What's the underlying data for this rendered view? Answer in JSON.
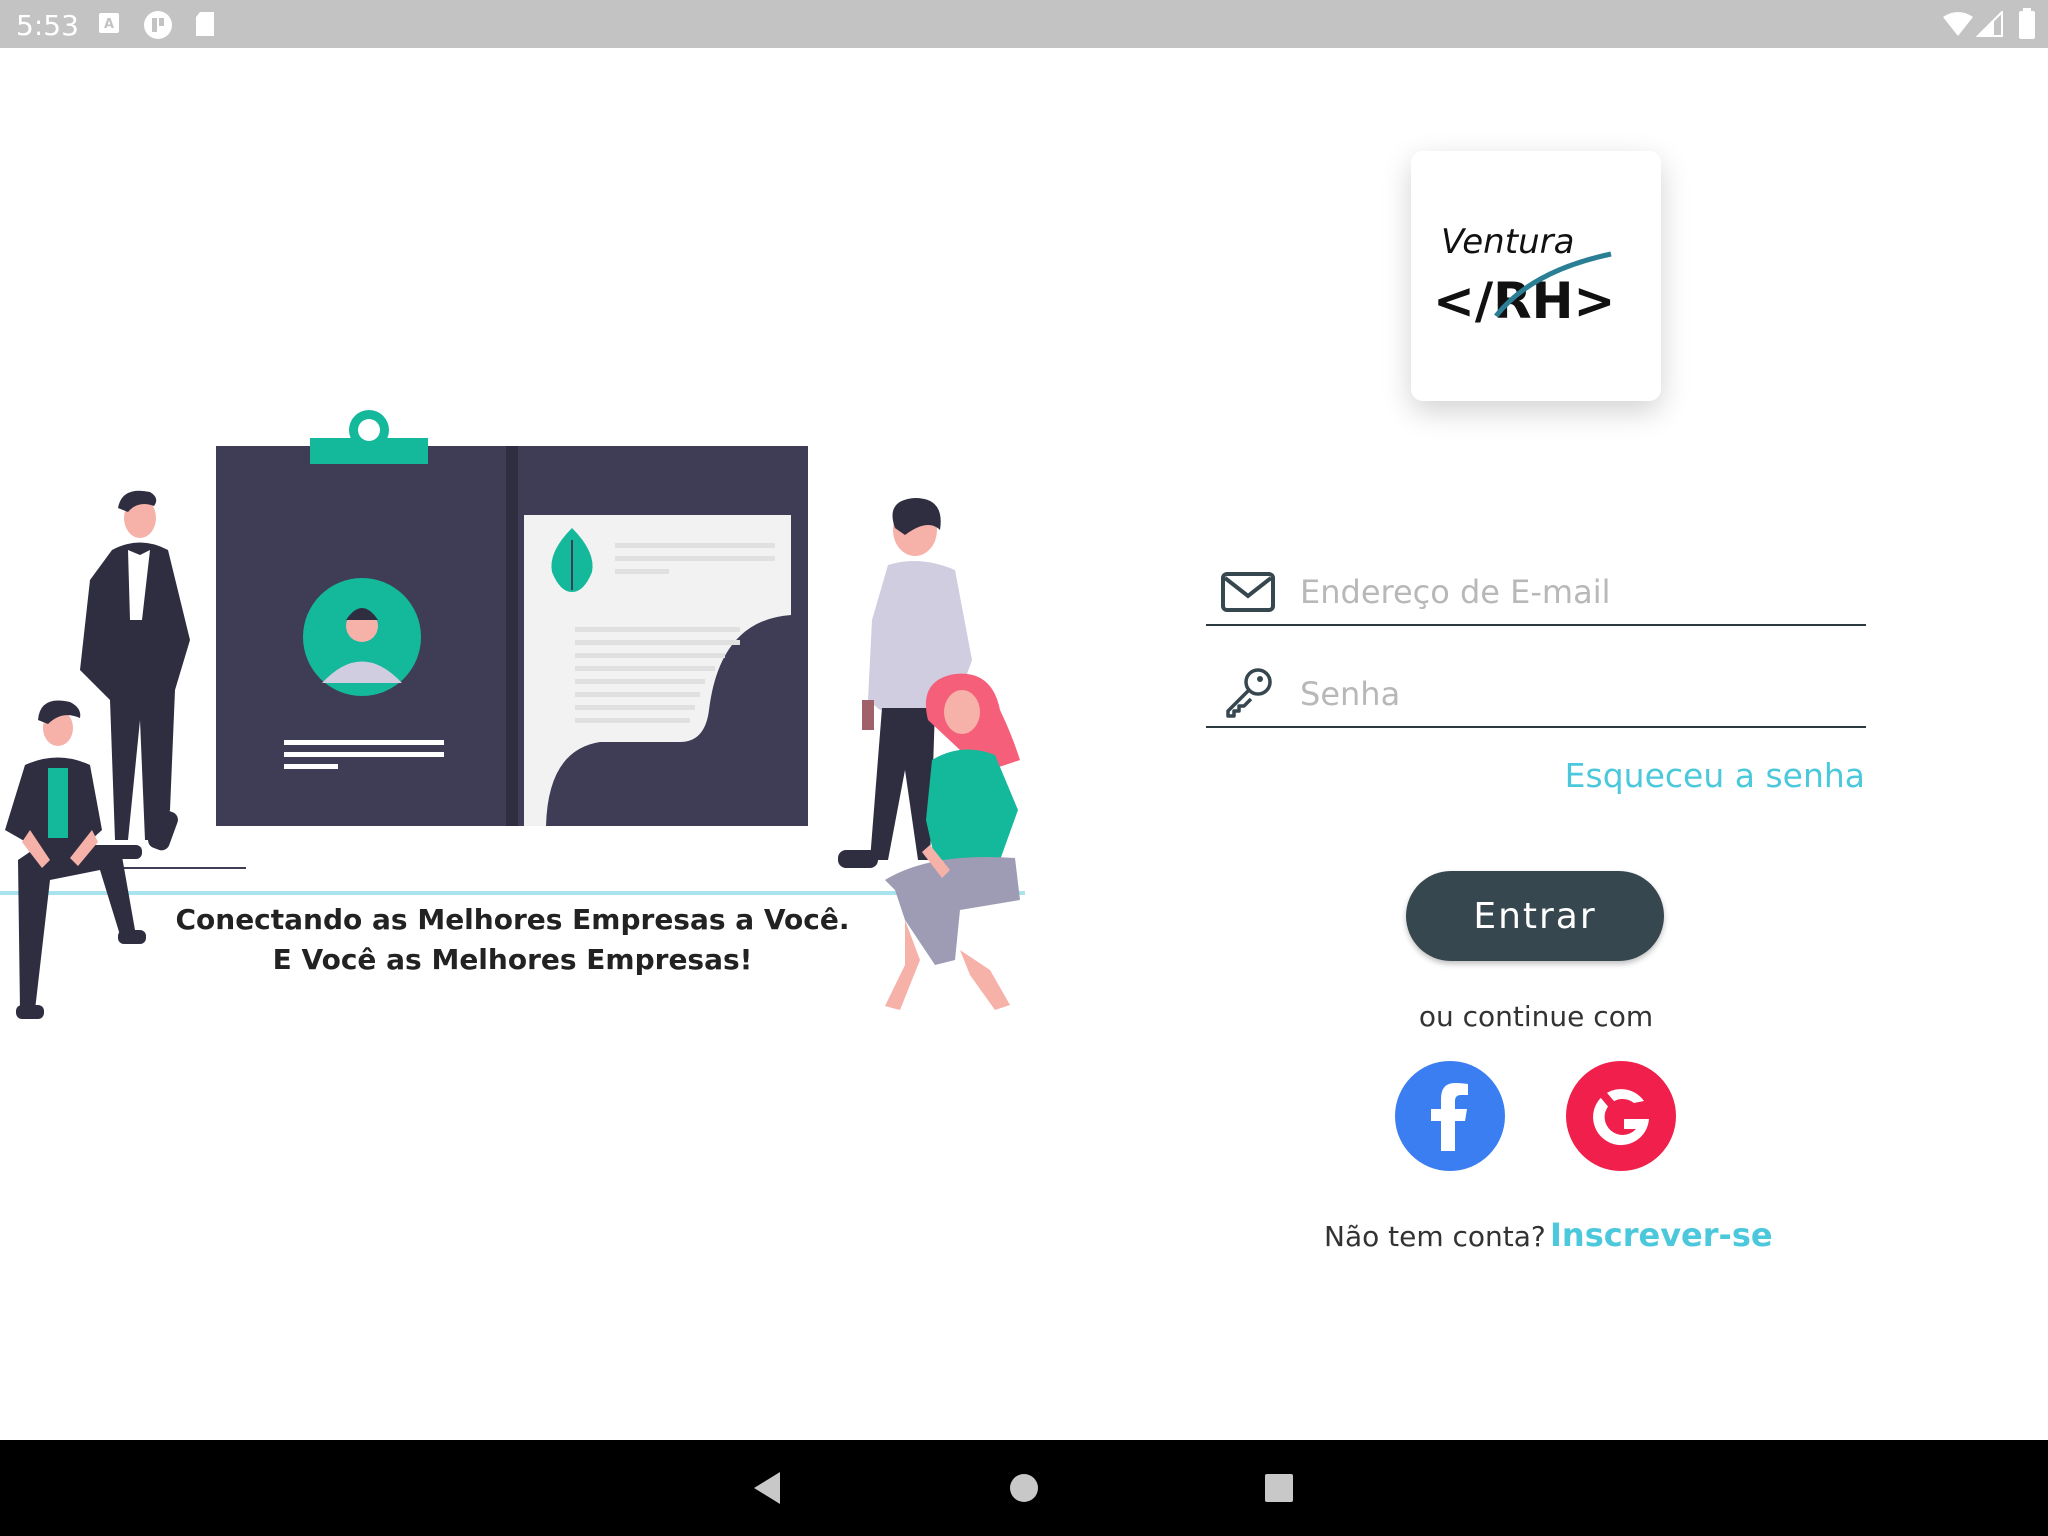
{
  "status_bar": {
    "time": "5:53",
    "icons": [
      "a-notification-icon",
      "app-notification-icon",
      "sd-card-icon",
      "wifi-icon",
      "signal-icon",
      "battery-icon"
    ]
  },
  "illustration": {
    "tagline_line1": "Conectando as Melhores Empresas a Você.",
    "tagline_line2": "E Você as Melhores Empresas!"
  },
  "logo": {
    "text_top": "Ventura",
    "text_bottom": "</RH>"
  },
  "form": {
    "email_placeholder": "Endereço de E-mail",
    "password_placeholder": "Senha",
    "forgot_password": "Esqueceu a senha",
    "login_button": "Entrar",
    "or_continue": "ou continue com",
    "no_account": "Não tem conta?",
    "signup": "Inscrever-se"
  },
  "social": {
    "facebook_letter": "f",
    "google_letter": "G"
  },
  "colors": {
    "accent": "#4cc8dc",
    "button": "#37474f",
    "facebook": "#3b7ef2",
    "google": "#f01f4b",
    "illustration_teal": "#14b89a",
    "illustration_dark": "#3f3d56"
  },
  "nav_bar": {
    "buttons": [
      "back-icon",
      "home-icon",
      "recents-icon"
    ]
  }
}
